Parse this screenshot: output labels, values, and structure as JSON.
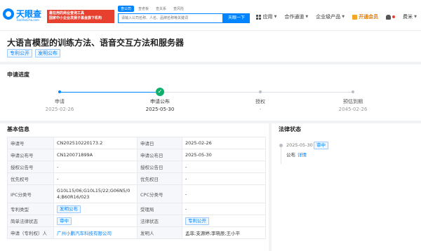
{
  "header": {
    "logo_text": "天眼查",
    "logo_sub": "TianYanCha.com",
    "promo_line1": "最在用的商业查询工具",
    "promo_line2": "国家中小企业发展子基金旗下机构",
    "search_tabs": [
      "查公司",
      "查老板",
      "查关系",
      "查风险"
    ],
    "search_placeholder": "请输入公司名称、人名、品牌名称等关键词",
    "search_button": "天眼一下",
    "nav": {
      "apps": "应用",
      "partner": "合作通道",
      "enterprise": "企业级产品",
      "vip": "开通会员",
      "user": "费米"
    }
  },
  "title": {
    "text": "大语言模型的训练方法、语音交互方法和服务器",
    "tags": [
      "专利公开",
      "发明公布"
    ]
  },
  "progress": {
    "title": "申请进度",
    "steps": [
      {
        "label": "申请",
        "date": "2025-02-26"
      },
      {
        "label": "申请公布",
        "date": "2025-05-30",
        "check": "✓"
      },
      {
        "label": "授权",
        "date": "-"
      },
      {
        "label": "预估到期",
        "date": "2045-02-26"
      }
    ]
  },
  "basic_info": {
    "title": "基本信息",
    "rows": [
      {
        "l1": "申请号",
        "v1": "CN202510220173.2",
        "l2": "申请日",
        "v2": "2025-02-26"
      },
      {
        "l1": "申请公布号",
        "v1": "CN120071899A",
        "l2": "申请公布日",
        "v2": "2025-05-30"
      },
      {
        "l1": "授权公告号",
        "v1": "-",
        "l2": "授权公告日",
        "v2": "-"
      },
      {
        "l1": "优先权号",
        "v1": "-",
        "l2": "优先权日",
        "v2": "-"
      },
      {
        "l1": "IPC分类号",
        "v1": "G10L15/06;G10L15/22;G06N5/04;B60R16/023",
        "l2": "CPC分类号",
        "v2": "-"
      },
      {
        "l1": "专利类型",
        "v1": "发明公布",
        "l2": "受理局",
        "v2": "-"
      },
      {
        "l1": "简单法律状态",
        "v1": "审中",
        "l2": "法律状态",
        "v2": "专利公开"
      },
      {
        "l1": "申请（专利权）人",
        "v1": "广州小鹏汽车科技有限公司",
        "l2": "发明人",
        "v2": "孟菲;支源婷;李晓辰;王小平"
      }
    ]
  },
  "legal_status": {
    "title": "法律状态",
    "date": "2025-05-30",
    "badge": "审中",
    "desc": "公布",
    "detail_link": "详情"
  },
  "colors": {
    "brand": "#0084ff",
    "promo": "#e8402f",
    "success": "#0cb06a",
    "vip": "#e07b00"
  }
}
